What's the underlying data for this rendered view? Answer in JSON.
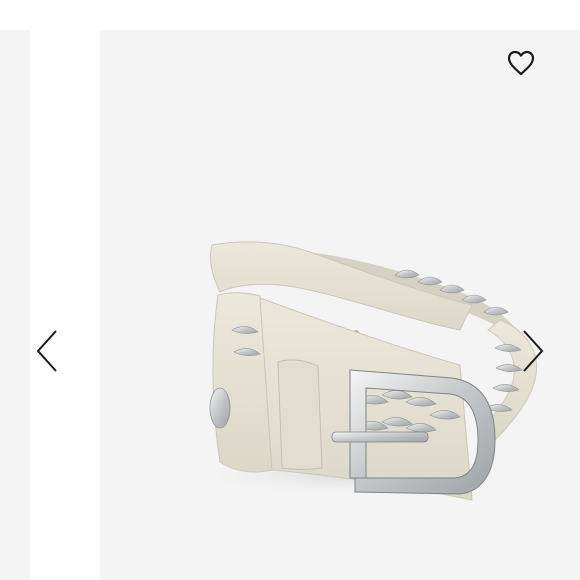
{
  "carousel": {
    "prev_label": "",
    "next_label": "",
    "wishlist_label": ""
  },
  "product": {
    "image_description": ""
  },
  "icons": {
    "wishlist": "heart-outline-icon",
    "previous": "chevron-left-icon",
    "next": "chevron-right-icon"
  },
  "colors": {
    "background": "#ffffff",
    "slide_background": "#f4f4f4",
    "icon": "#1a1a1a",
    "leather": "#e6e2d4",
    "metal": "#c9cbcc"
  }
}
